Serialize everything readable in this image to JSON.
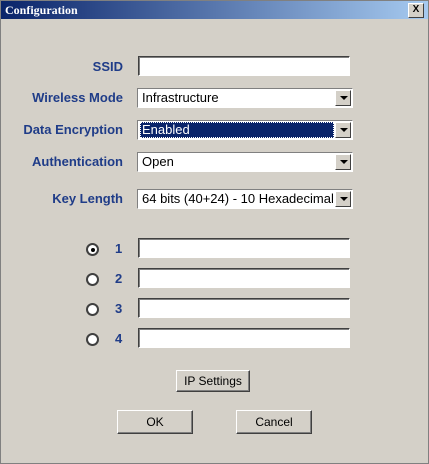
{
  "window": {
    "title": "Configuration",
    "close_label": "X"
  },
  "labels": {
    "ssid": "SSID",
    "wireless_mode": "Wireless Mode",
    "data_encryption": "Data Encryption",
    "authentication": "Authentication",
    "key_length": "Key Length"
  },
  "fields": {
    "ssid_value": "",
    "wireless_mode_value": "Infrastructure",
    "data_encryption_value": "Enabled",
    "authentication_value": "Open",
    "key_length_value": "64 bits (40+24) - 10 Hexadecimal"
  },
  "keys": [
    {
      "num": "1",
      "value": "",
      "selected": true
    },
    {
      "num": "2",
      "value": "",
      "selected": false
    },
    {
      "num": "3",
      "value": "",
      "selected": false
    },
    {
      "num": "4",
      "value": "",
      "selected": false
    }
  ],
  "buttons": {
    "ip_settings": "IP Settings",
    "ok": "OK",
    "cancel": "Cancel"
  }
}
